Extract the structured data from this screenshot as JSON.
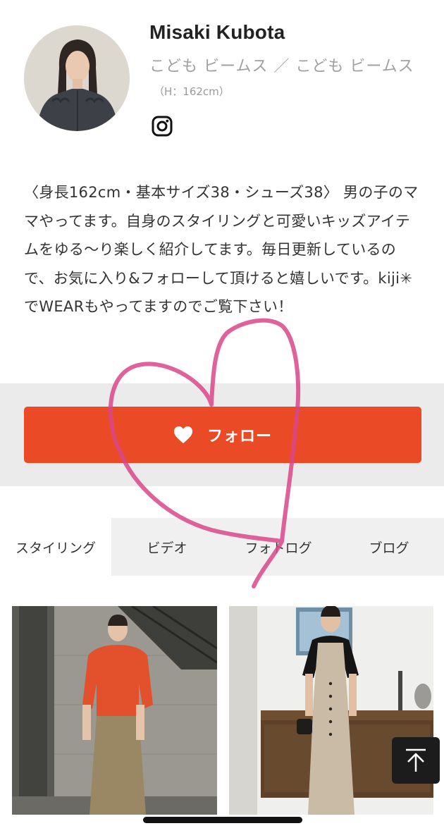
{
  "profile": {
    "name": "Misaki Kubota",
    "shop": "こども ビームス ／ こども ビームス",
    "height": "（H：162cm）",
    "instagram_icon": "instagram-icon"
  },
  "bio": "〈身長162cm・基本サイズ38・シューズ38〉 男の子のママやってます。自身のスタイリングと可愛いキッズアイテムをゆる〜り楽しく紹介してます。毎日更新しているので、お気に入り&フォローして頂けると嬉しいです。kiji✳︎でWEARもやってますのでご覧下さい！",
  "follow": {
    "label": "フォロー",
    "icon": "heart-icon",
    "color": "#ea4b26"
  },
  "tabs": [
    {
      "label": "スタイリング",
      "active": true
    },
    {
      "label": "ビデオ",
      "active": false
    },
    {
      "label": "フォトログ",
      "active": false
    },
    {
      "label": "ブログ",
      "active": false
    }
  ],
  "gallery": [
    {
      "icon": "styling-photo"
    },
    {
      "icon": "styling-photo"
    }
  ],
  "scroll_top": {
    "icon": "arrow-up-to-top-icon"
  },
  "colors": {
    "accent": "#ea4b26",
    "scribble": "#d9468a"
  }
}
